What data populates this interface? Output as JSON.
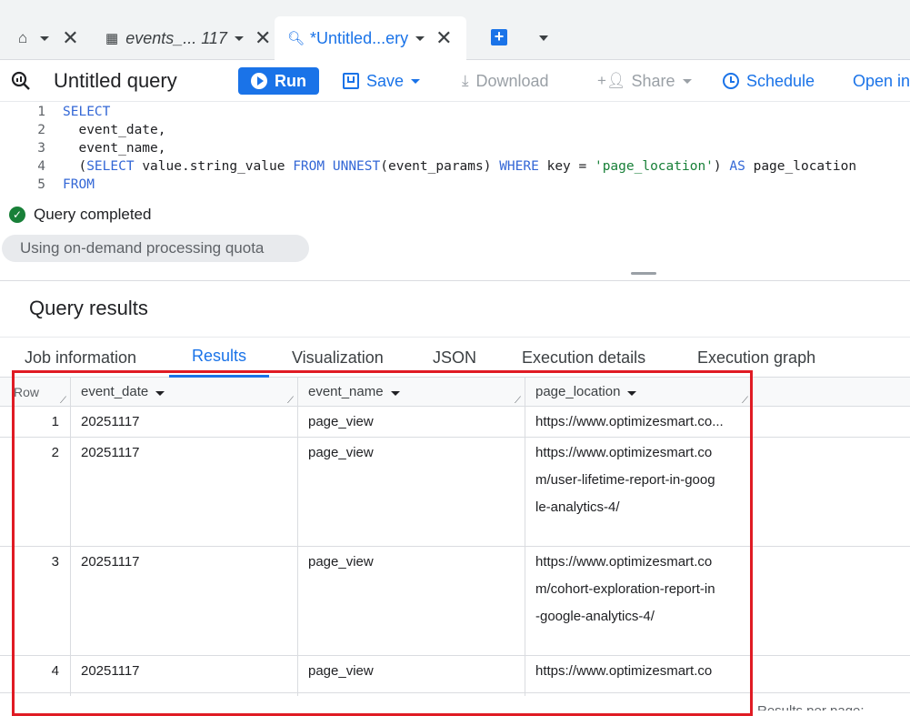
{
  "tabs": {
    "home_label": "",
    "tab1": {
      "title": "events_... 117"
    },
    "tab2": {
      "title": "*Untitled...ery"
    }
  },
  "toolbar": {
    "title": "Untitled query",
    "run": "Run",
    "save": "Save",
    "download": "Download",
    "share": "Share",
    "schedule": "Schedule",
    "open_in": "Open in"
  },
  "editor": {
    "lines": [
      {
        "n": "1",
        "text": "SELECT"
      },
      {
        "n": "2",
        "text": "  event_date,"
      },
      {
        "n": "3",
        "text": "  event_name,"
      },
      {
        "n": "4",
        "text": "  (SELECT value.string_value FROM UNNEST(event_params) WHERE key = 'page_location') AS page_location"
      },
      {
        "n": "5",
        "text": "FROM"
      }
    ]
  },
  "status": {
    "message": "Query completed",
    "quota": "Using on-demand processing quota"
  },
  "results": {
    "title": "Query results",
    "tabs": [
      "Job information",
      "Results",
      "Visualization",
      "JSON",
      "Execution details",
      "Execution graph"
    ],
    "active_tab": "Results",
    "columns": [
      "Row",
      "event_date",
      "event_name",
      "page_location"
    ],
    "rows": [
      {
        "row": "1",
        "event_date": "20251117",
        "event_name": "page_view",
        "page_location": [
          "https://www.optimizesmart.co..."
        ]
      },
      {
        "row": "2",
        "event_date": "20251117",
        "event_name": "page_view",
        "page_location": [
          "https://www.optimizesmart.co",
          "m/user-lifetime-report-in-goog",
          "le-analytics-4/"
        ]
      },
      {
        "row": "3",
        "event_date": "20251117",
        "event_name": "page_view",
        "page_location": [
          "https://www.optimizesmart.co",
          "m/cohort-exploration-report-in",
          "-google-analytics-4/"
        ]
      },
      {
        "row": "4",
        "event_date": "20251117",
        "event_name": "page_view",
        "page_location": [
          "https://www.optimizesmart.co"
        ]
      }
    ],
    "footer": "Results per page:"
  },
  "colors": {
    "accent": "#1a73e8",
    "highlight": "#e01b24",
    "success": "#188038"
  }
}
